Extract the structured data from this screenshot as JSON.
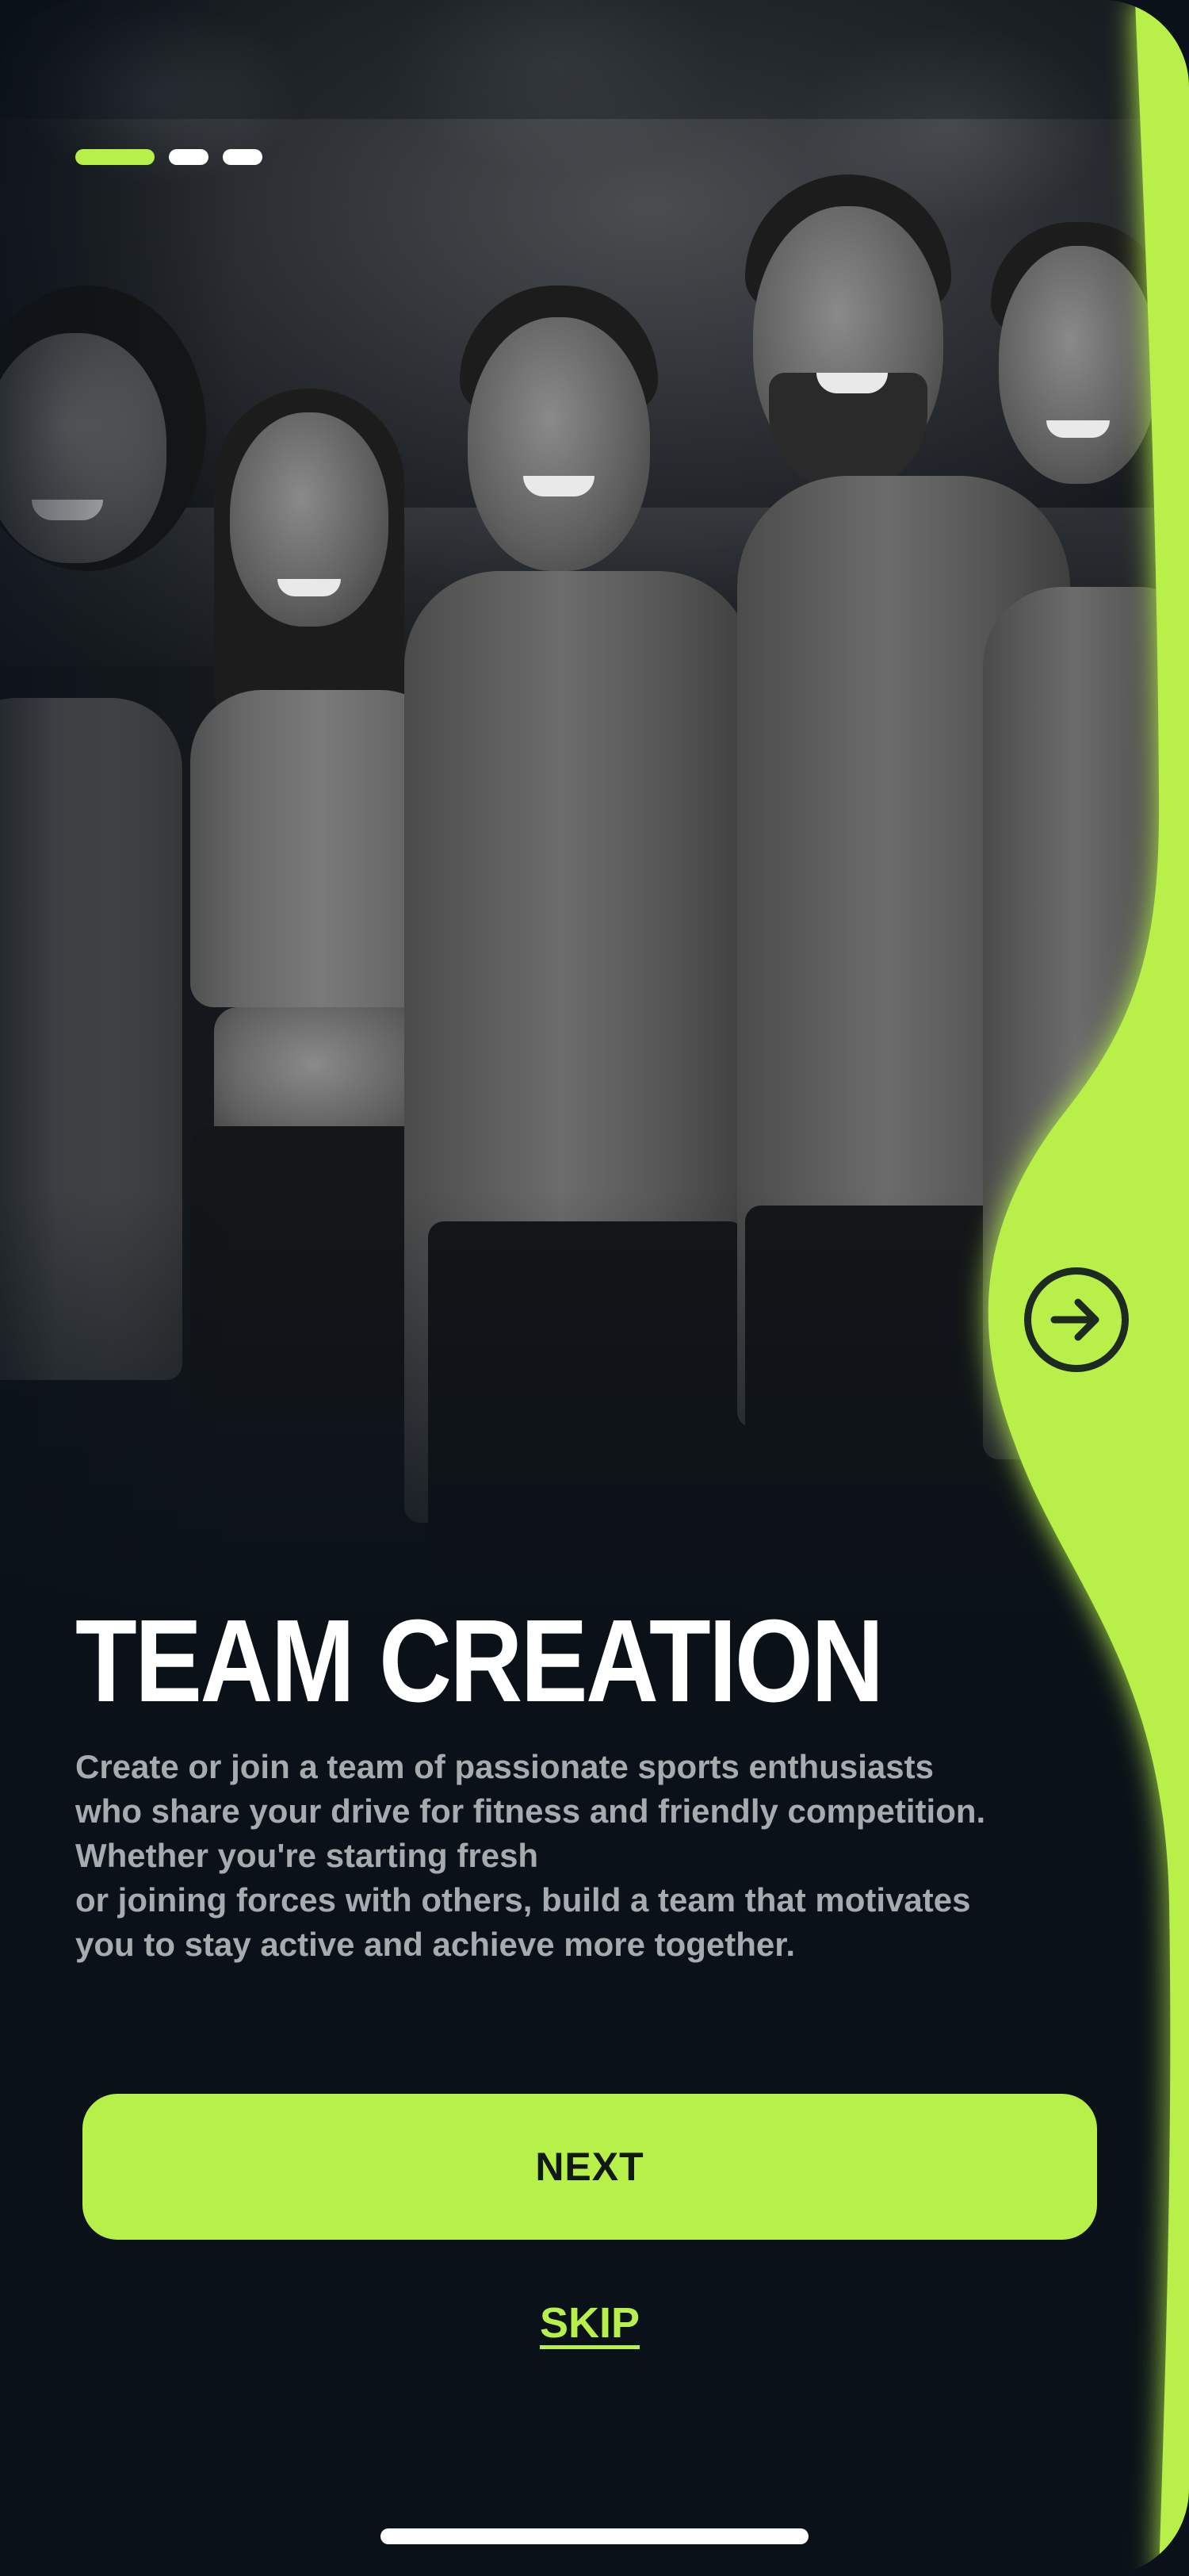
{
  "onboarding": {
    "step_count": 3,
    "active_step": 1,
    "title": "TEAM CREATION",
    "description_lines": [
      "Create or join a team of passionate sports enthusiasts",
      "who share your drive for fitness and friendly competition.",
      "Whether you're starting fresh",
      "or joining forces with others, build a team that motivates",
      "you to stay active and achieve more together."
    ],
    "next_label": "NEXT",
    "skip_label": "SKIP"
  },
  "icons": {
    "forward": "arrow-right-circle-icon"
  },
  "colors": {
    "accent": "#b8f04a",
    "background": "#0a1118",
    "text_primary": "#ffffff",
    "text_secondary": "#a8abae",
    "button_text": "#101a12"
  }
}
